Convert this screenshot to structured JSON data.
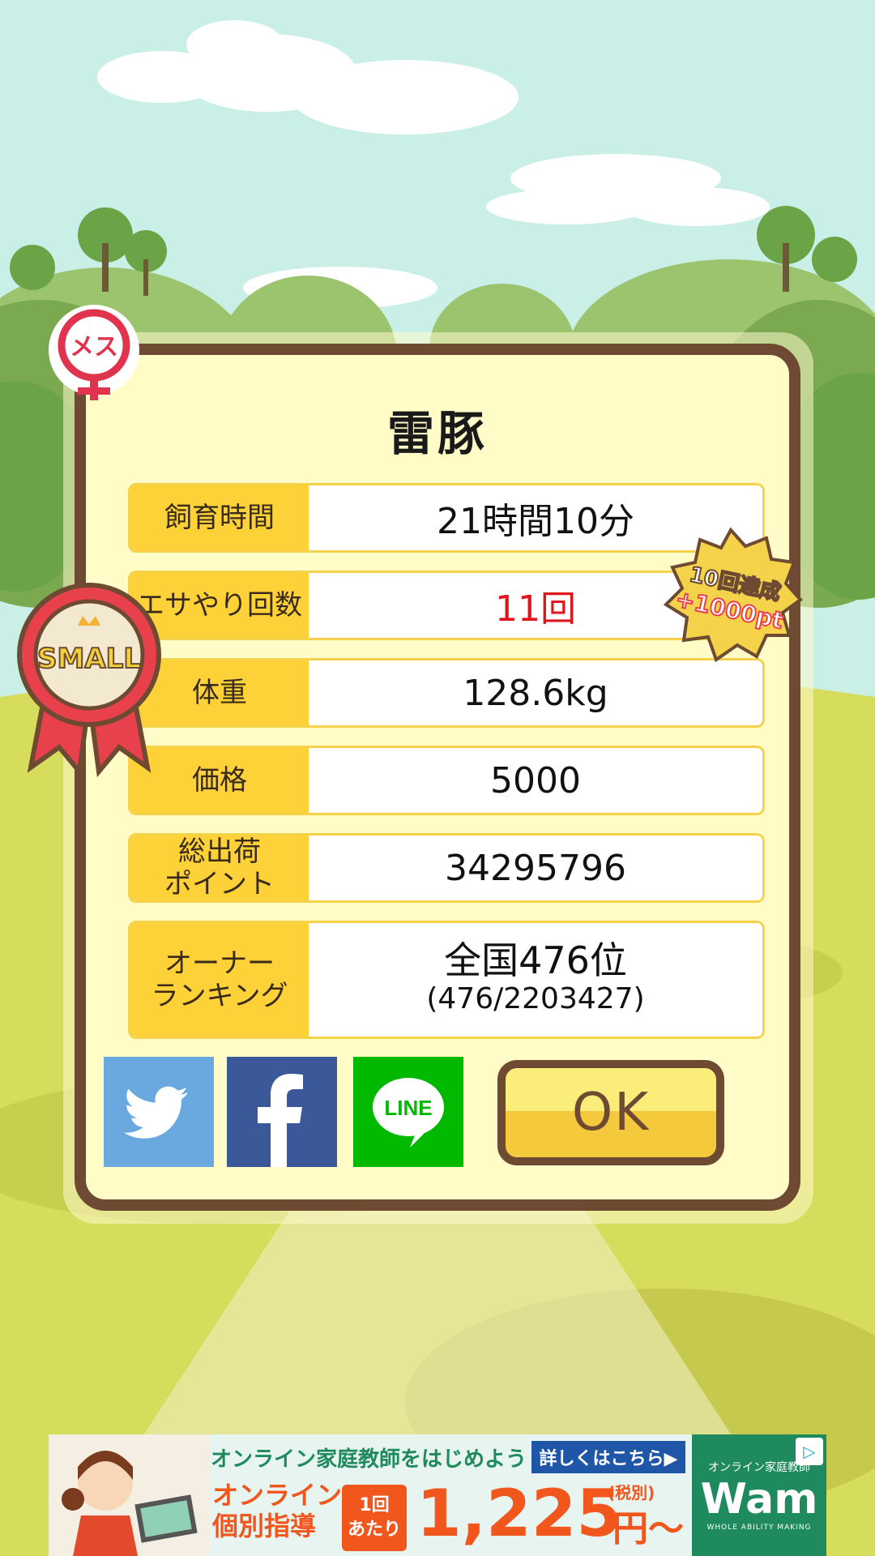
{
  "dialog": {
    "title": "雷豚",
    "rows": [
      {
        "label": "飼育時間",
        "value": "21時間10分"
      },
      {
        "label": "エサやり回数",
        "value": "11回"
      },
      {
        "label": "体重",
        "value": "128.6kg"
      },
      {
        "label": "価格",
        "value": "5000"
      },
      {
        "label_line1": "総出荷",
        "label_line2": "ポイント",
        "value": "34295796"
      },
      {
        "label_line1": "オーナー",
        "label_line2": "ランキング",
        "value_main": "全国476位",
        "value_sub": "(476/2203427)"
      }
    ],
    "ok_label": "OK"
  },
  "badges": {
    "gender": "メス",
    "size": "SMALL",
    "achievement_line1": "10回達成",
    "achievement_line2": "+1000pt"
  },
  "social": {
    "twitter_icon": "twitter-icon",
    "facebook_icon": "facebook-icon",
    "line_icon": "line-icon",
    "line_label": "LINE"
  },
  "ad": {
    "headline": "オンライン家庭教師をはじめよう",
    "detail_button": "詳しくはこちら▶",
    "service_line1": "オンライン",
    "service_line2": "個別指導",
    "per_line1": "1回",
    "per_line2": "あたり",
    "price": "1,225",
    "tax": "(税別)",
    "yen": "円〜",
    "brand_small": "オンライン家庭教師",
    "brand_name": "Wam",
    "brand_tagline": "WHOLE ABILITY MAKING",
    "adchoice_icon": "adchoices-icon"
  },
  "colors": {
    "frame_brown": "#6e4a33",
    "label_yellow": "#fdd238",
    "panel_cream": "#fffcc8",
    "highlight_red": "#e1151c",
    "twitter_blue": "#6aa9e0",
    "facebook_blue": "#3b5998",
    "line_green": "#00b900"
  }
}
